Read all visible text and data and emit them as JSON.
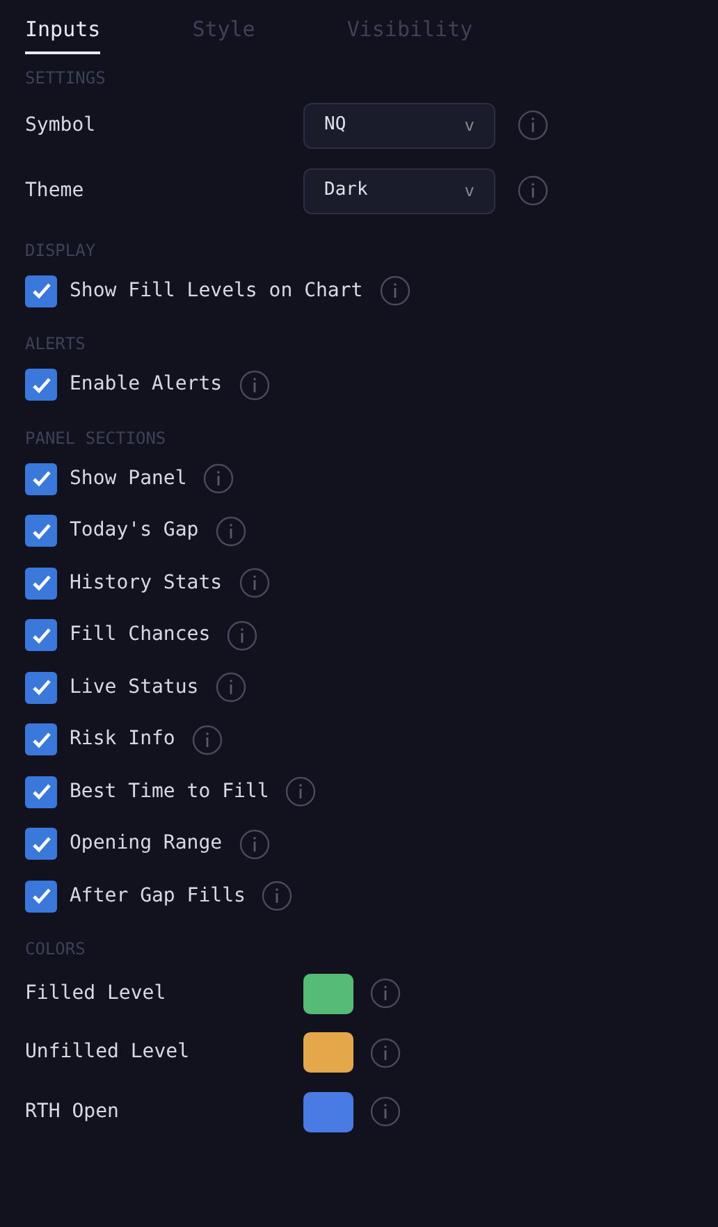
{
  "tabs": [
    {
      "label": "Inputs",
      "selected": true
    },
    {
      "label": "Style",
      "selected": false
    },
    {
      "label": "Visibility",
      "selected": false
    }
  ],
  "sections": [
    {
      "title": "SETTINGS",
      "items": [
        {
          "kind": "select",
          "label": "Symbol",
          "value": "NQ",
          "caret": "v"
        },
        {
          "kind": "select",
          "label": "Theme",
          "value": "Dark",
          "caret": "v"
        }
      ]
    },
    {
      "title": "DISPLAY",
      "items": [
        {
          "kind": "checkbox",
          "label": "Show Fill Levels on Chart",
          "checked": true
        }
      ]
    },
    {
      "title": "ALERTS",
      "items": [
        {
          "kind": "checkbox",
          "label": "Enable Alerts",
          "checked": true
        }
      ]
    },
    {
      "title": "PANEL SECTIONS",
      "items": [
        {
          "kind": "checkbox",
          "label": "Show Panel",
          "checked": true
        },
        {
          "kind": "checkbox",
          "label": "Today's Gap",
          "checked": true
        },
        {
          "kind": "checkbox",
          "label": "History Stats",
          "checked": true
        },
        {
          "kind": "checkbox",
          "label": "Fill Chances",
          "checked": true
        },
        {
          "kind": "checkbox",
          "label": "Live Status",
          "checked": true
        },
        {
          "kind": "checkbox",
          "label": "Risk Info",
          "checked": true
        },
        {
          "kind": "checkbox",
          "label": "Best Time to Fill",
          "checked": true
        },
        {
          "kind": "checkbox",
          "label": "Opening Range",
          "checked": true
        },
        {
          "kind": "checkbox",
          "label": "After Gap Fills",
          "checked": true
        }
      ]
    },
    {
      "title": "COLORS",
      "items": [
        {
          "kind": "color",
          "label": "Filled Level",
          "color": "#55bb77"
        },
        {
          "kind": "color",
          "label": "Unfilled Level",
          "color": "#e4a84a"
        },
        {
          "kind": "color",
          "label": "RTH Open",
          "color": "#4a7ae4"
        }
      ]
    }
  ]
}
